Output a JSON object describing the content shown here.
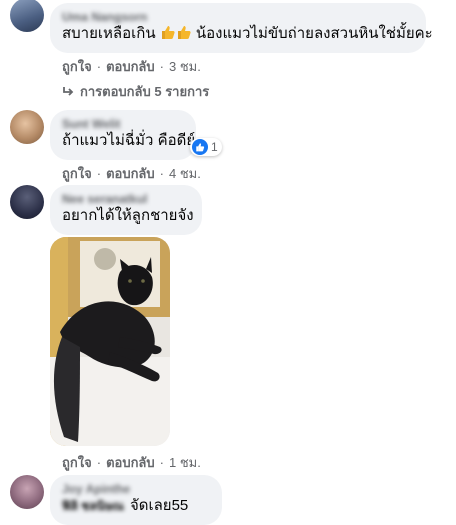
{
  "comments": [
    {
      "author": "Uma Nangsorn",
      "text_before": "สบายเหลือเกิน ",
      "text_after": " น้องแมวไม่ขับถ่ายลงสวนหินใช่มั้ยคะ",
      "emoji_icon": "thumbs-up-emoji",
      "like_label": "ถูกใจ",
      "reply_label": "ตอบกลับ",
      "time": "3 ชม.",
      "replies_label": "การตอบกลับ 5 รายการ"
    },
    {
      "author": "Sunt Welit",
      "text": "ถ้าแมวไม่ฉี่มั่ว คือดีย์",
      "reaction_count": "1",
      "like_label": "ถูกใจ",
      "reply_label": "ตอบกลับ",
      "time": "4 ชม."
    },
    {
      "author": "Nee seranatkul",
      "text": "อยากได้ให้ลูกชายจัง",
      "like_label": "ถูกใจ",
      "reply_label": "ตอบกลับ",
      "time": "1 ชม."
    },
    {
      "author": "Joy Apinthe",
      "author2": "ฟิลิ ชลนิษณ",
      "text": "จัดเลย55"
    }
  ],
  "colors": {
    "bubble": "#f0f2f5",
    "meta_text": "#65676b",
    "like_blue": "#1877f2",
    "emoji_yellow": "#f5b62b"
  }
}
